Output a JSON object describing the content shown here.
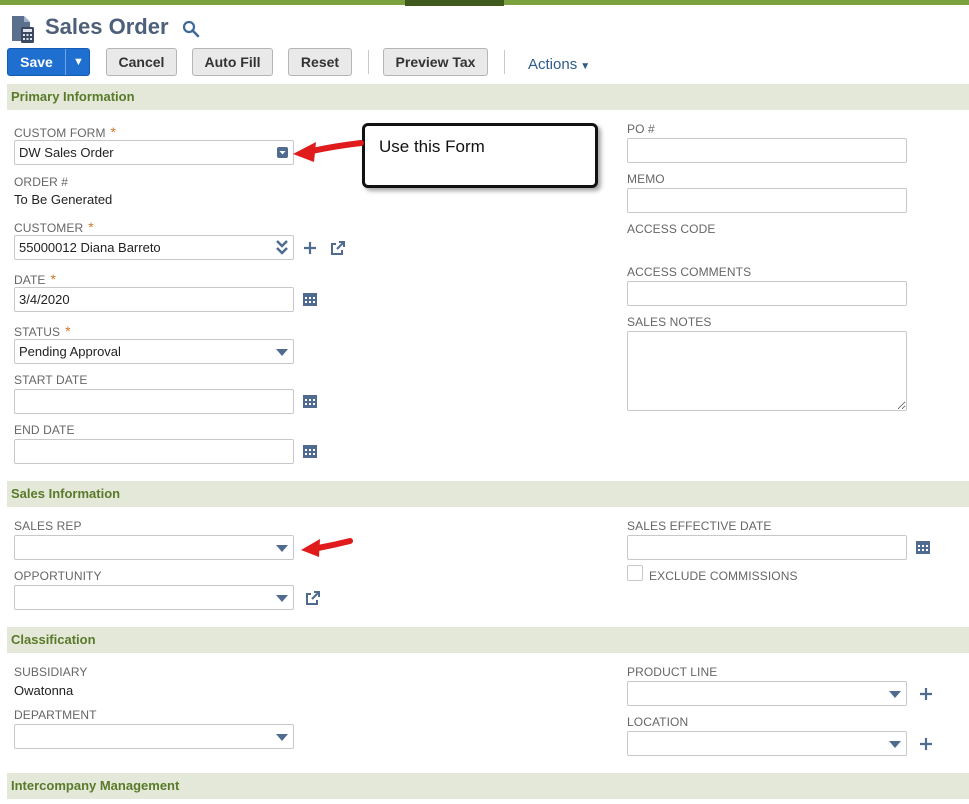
{
  "header": {
    "title": "Sales Order"
  },
  "toolbar": {
    "save": "Save",
    "cancel": "Cancel",
    "auto_fill": "Auto Fill",
    "reset": "Reset",
    "preview_tax": "Preview Tax",
    "actions": "Actions"
  },
  "sections": {
    "primary": "Primary Information",
    "sales": "Sales Information",
    "classification": "Classification",
    "intercompany": "Intercompany Management"
  },
  "primary": {
    "custom_form": {
      "label": "CUSTOM FORM",
      "value": "DW Sales Order"
    },
    "order_no": {
      "label": "ORDER #",
      "value": "To Be Generated"
    },
    "customer": {
      "label": "CUSTOMER",
      "value": "55000012 Diana Barreto"
    },
    "date": {
      "label": "DATE",
      "value": "3/4/2020"
    },
    "status": {
      "label": "STATUS",
      "value": "Pending Approval"
    },
    "start_date": {
      "label": "START DATE",
      "value": ""
    },
    "end_date": {
      "label": "END DATE",
      "value": ""
    },
    "po": {
      "label": "PO #",
      "value": ""
    },
    "memo": {
      "label": "MEMO",
      "value": ""
    },
    "access_code": {
      "label": "ACCESS CODE",
      "value": ""
    },
    "access_comments": {
      "label": "ACCESS COMMENTS",
      "value": ""
    },
    "sales_notes": {
      "label": "SALES NOTES",
      "value": ""
    }
  },
  "sales": {
    "sales_rep": {
      "label": "SALES REP",
      "value": ""
    },
    "opportunity": {
      "label": "OPPORTUNITY",
      "value": ""
    },
    "sales_effective_date": {
      "label": "SALES EFFECTIVE DATE",
      "value": ""
    },
    "exclude_commissions": {
      "label": "EXCLUDE COMMISSIONS",
      "checked": false
    }
  },
  "classification": {
    "subsidiary": {
      "label": "SUBSIDIARY",
      "value": "Owatonna"
    },
    "department": {
      "label": "DEPARTMENT",
      "value": ""
    },
    "product_line": {
      "label": "PRODUCT LINE",
      "value": ""
    },
    "location": {
      "label": "LOCATION",
      "value": ""
    }
  },
  "annotation": {
    "callout_text": "Use this Form"
  },
  "icons": {
    "page": "sales-order-page-icon",
    "search": "search-icon",
    "dropdown": "chevron-down-icon",
    "calendar": "calendar-icon",
    "add": "plus-icon",
    "open": "open-external-icon"
  },
  "colors": {
    "brand_green": "#7aa13e",
    "section_bg": "#e3e8d8",
    "section_text": "#5a7a2a",
    "primary_button": "#1f6fd1",
    "required": "#d2772b",
    "annotation_arrow": "#e01b1b"
  }
}
